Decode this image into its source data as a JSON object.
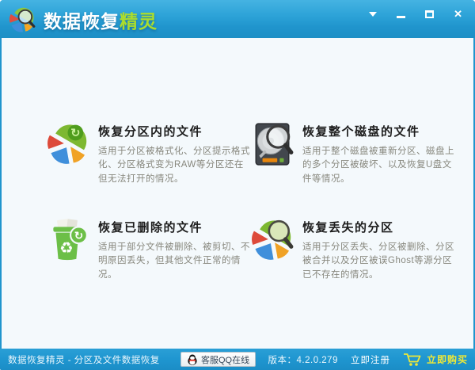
{
  "titlebar": {
    "title_main": "数据恢复",
    "title_accent": "精灵",
    "icons": [
      "menu-arrow-icon",
      "minimize-icon",
      "maximize-icon",
      "close-icon"
    ]
  },
  "options": [
    {
      "title": "恢复分区内的文件",
      "desc": "适用于分区被格式化、分区提示格式化、分区格式变为RAW等分区还在但无法打开的情况。",
      "icon": "partition-pie-refresh-icon"
    },
    {
      "title": "恢复整个磁盘的文件",
      "desc": "适用于整个磁盘被重新分区、磁盘上的多个分区被破坏、以及恢复U盘文件等情况。",
      "icon": "disk-magnifier-icon"
    },
    {
      "title": "恢复已删除的文件",
      "desc": "适用于部分文件被删除、被剪切、不明原因丢失，但其他文件正常的情况。",
      "icon": "recycle-bin-refresh-icon"
    },
    {
      "title": "恢复丢失的分区",
      "desc": "适用于分区丢失、分区被删除、分区被合并以及分区被误Ghost等源分区已不存在的情况。",
      "icon": "lost-partition-pie-magnifier-icon"
    }
  ],
  "statusbar": {
    "app_label": "数据恢复精灵 - 分区及文件数据恢复",
    "qq_button_label": "客服QQ在线",
    "version_label": "版本：4.2.0.279",
    "register_label": "立即注册",
    "buy_label": "立即购买"
  },
  "colors": {
    "titlebar_blue": "#2095cd",
    "statusbar_blue": "#1f96d0",
    "accent_green": "#aadc2e",
    "buy_yellow": "#eee838",
    "content_bg": "#f4f9fc"
  }
}
